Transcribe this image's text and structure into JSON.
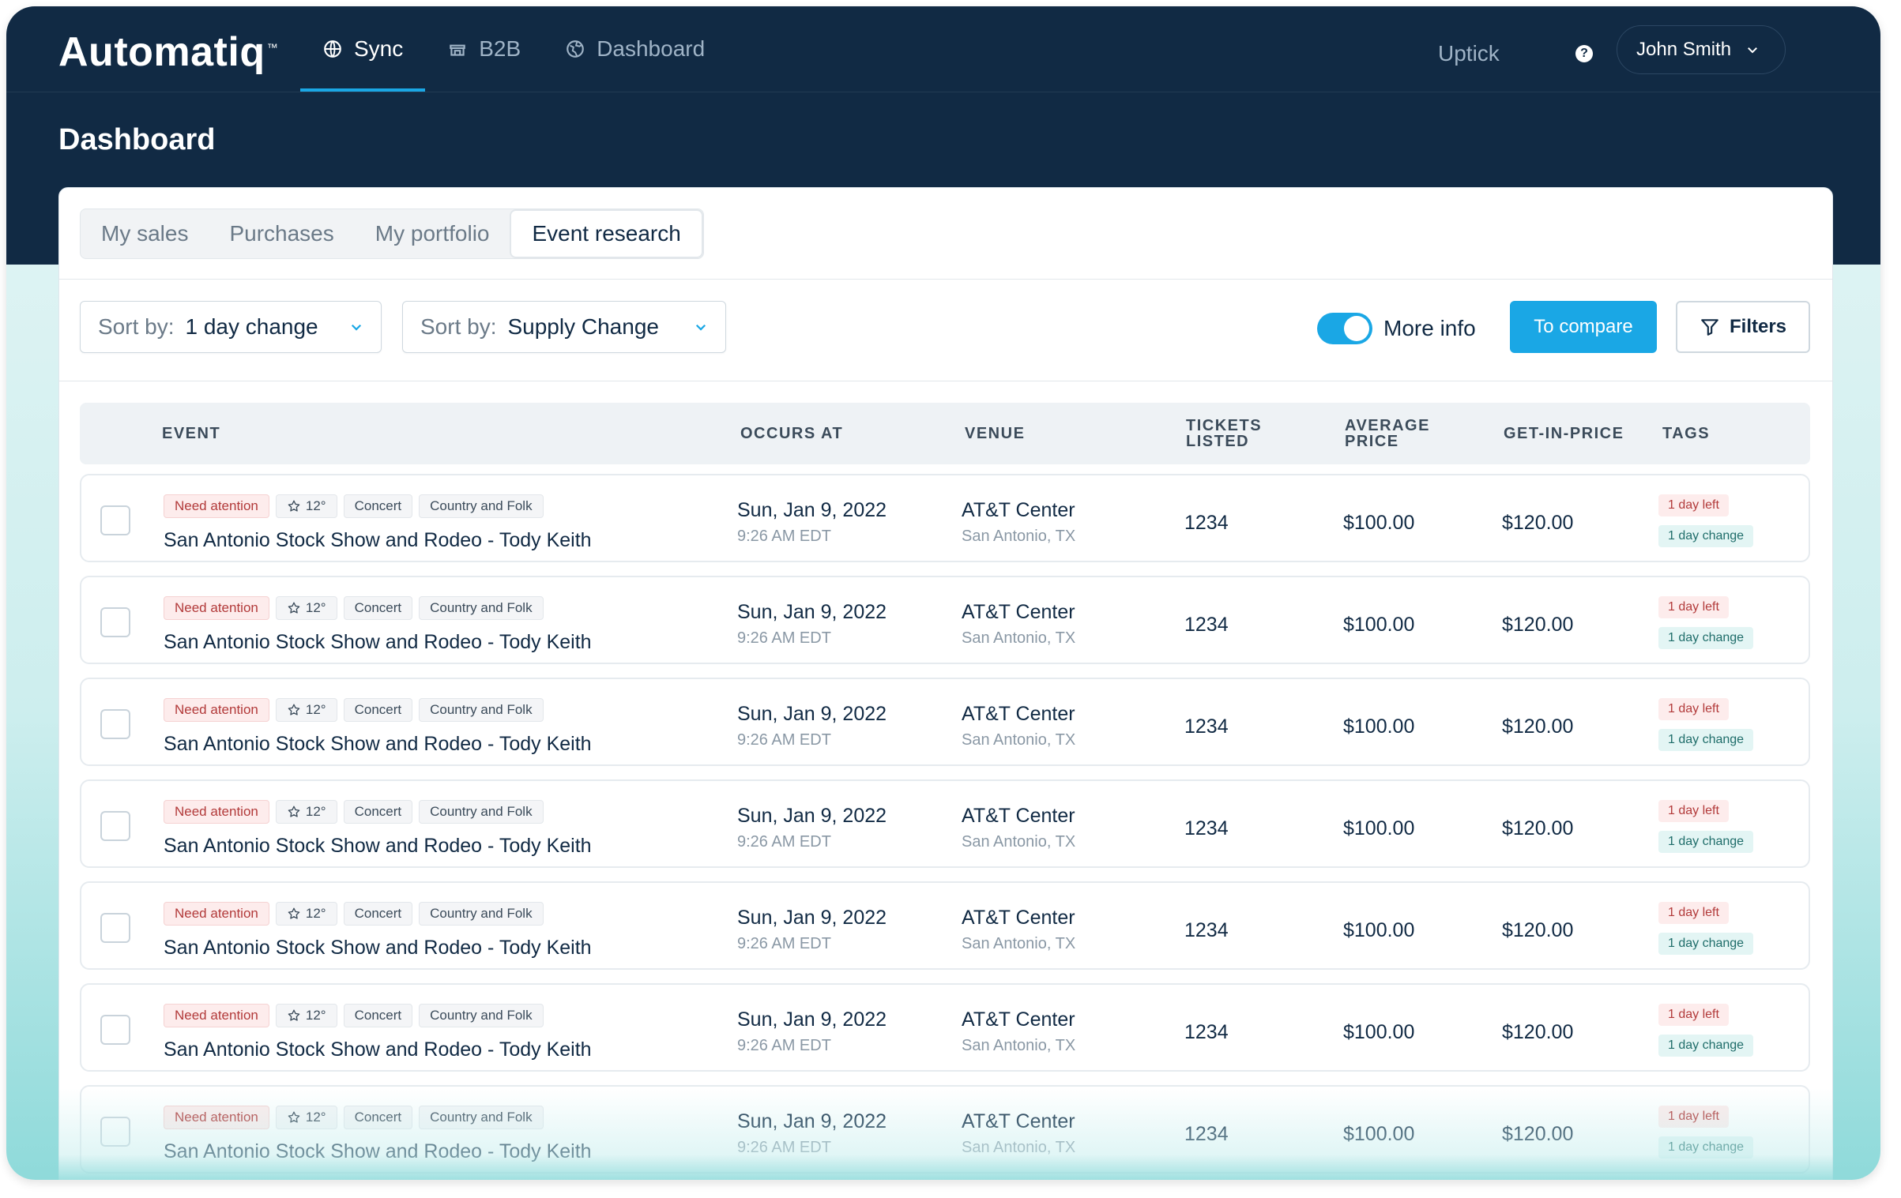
{
  "app": {
    "logo": "Automatiq",
    "logo_tm": "™",
    "nav": [
      {
        "label": "Sync",
        "icon": "globe-icon",
        "active": true
      },
      {
        "label": "B2B",
        "icon": "store-icon",
        "active": false
      },
      {
        "label": "Dashboard",
        "icon": "globe-icon",
        "active": false
      }
    ],
    "uptick": "Uptick",
    "help": "?",
    "user": "John Smith"
  },
  "page": {
    "title": "Dashboard",
    "tabs": [
      "My sales",
      "Purchases",
      "My portfolio",
      "Event research"
    ],
    "active_tab": "Event research"
  },
  "toolbar": {
    "sort1": {
      "label": "Sort by:",
      "value": "1 day change"
    },
    "sort2": {
      "label": "Sort by:",
      "value": "Supply Change"
    },
    "toggle_label": "More info",
    "toggle_on": true,
    "compare_label": "To compare",
    "filters_label": "Filters"
  },
  "table": {
    "headers": {
      "event": "EVENT",
      "occurs": "OCCURS AT",
      "venue": "VENUE",
      "tickets": "TICKETS LISTED",
      "avg": "AVERAGE PRICE",
      "gip": "GET-IN-PRICE",
      "tags": "TAGS"
    },
    "rows": [
      {
        "chips": [
          "Need atention",
          "12°",
          "Concert",
          "Country and Folk"
        ],
        "title": "San Antonio Stock Show and Rodeo - Tody Keith",
        "date": "Sun, Jan 9, 2022",
        "time": "9:26 AM EDT",
        "venue": "AT&T Center",
        "city": "San Antonio, TX",
        "tickets": "1234",
        "avg": "$100.00",
        "gip": "$120.00",
        "tag1": "1 day left",
        "tag2": "1 day change"
      },
      {
        "chips": [
          "Need atention",
          "12°",
          "Concert",
          "Country and Folk"
        ],
        "title": "San Antonio Stock Show and Rodeo - Tody Keith",
        "date": "Sun, Jan 9, 2022",
        "time": "9:26 AM EDT",
        "venue": "AT&T Center",
        "city": "San Antonio, TX",
        "tickets": "1234",
        "avg": "$100.00",
        "gip": "$120.00",
        "tag1": "1 day left",
        "tag2": "1 day change"
      },
      {
        "chips": [
          "Need atention",
          "12°",
          "Concert",
          "Country and Folk"
        ],
        "title": "San Antonio Stock Show and Rodeo - Tody Keith",
        "date": "Sun, Jan 9, 2022",
        "time": "9:26 AM EDT",
        "venue": "AT&T Center",
        "city": "San Antonio, TX",
        "tickets": "1234",
        "avg": "$100.00",
        "gip": "$120.00",
        "tag1": "1 day left",
        "tag2": "1 day change"
      },
      {
        "chips": [
          "Need atention",
          "12°",
          "Concert",
          "Country and Folk"
        ],
        "title": "San Antonio Stock Show and Rodeo - Tody Keith",
        "date": "Sun, Jan 9, 2022",
        "time": "9:26 AM EDT",
        "venue": "AT&T Center",
        "city": "San Antonio, TX",
        "tickets": "1234",
        "avg": "$100.00",
        "gip": "$120.00",
        "tag1": "1 day left",
        "tag2": "1 day change"
      },
      {
        "chips": [
          "Need atention",
          "12°",
          "Concert",
          "Country and Folk"
        ],
        "title": "San Antonio Stock Show and Rodeo - Tody Keith",
        "date": "Sun, Jan 9, 2022",
        "time": "9:26 AM EDT",
        "venue": "AT&T Center",
        "city": "San Antonio, TX",
        "tickets": "1234",
        "avg": "$100.00",
        "gip": "$120.00",
        "tag1": "1 day left",
        "tag2": "1 day change"
      },
      {
        "chips": [
          "Need atention",
          "12°",
          "Concert",
          "Country and Folk"
        ],
        "title": "San Antonio Stock Show and Rodeo - Tody Keith",
        "date": "Sun, Jan 9, 2022",
        "time": "9:26 AM EDT",
        "venue": "AT&T Center",
        "city": "San Antonio, TX",
        "tickets": "1234",
        "avg": "$100.00",
        "gip": "$120.00",
        "tag1": "1 day left",
        "tag2": "1 day change"
      },
      {
        "chips": [
          "Need atention",
          "12°",
          "Concert",
          "Country and Folk"
        ],
        "title": "San Antonio Stock Show and Rodeo - Tody Keith",
        "date": "Sun, Jan 9, 2022",
        "time": "9:26 AM EDT",
        "venue": "AT&T Center",
        "city": "San Antonio, TX",
        "tickets": "1234",
        "avg": "$100.00",
        "gip": "$120.00",
        "tag1": "1 day left",
        "tag2": "1 day change"
      }
    ]
  },
  "colors": {
    "header_bg": "#112a44",
    "accent": "#1aa7e5",
    "warn_chip": "#fdecec",
    "teal_tag": "#e3f5f4"
  }
}
